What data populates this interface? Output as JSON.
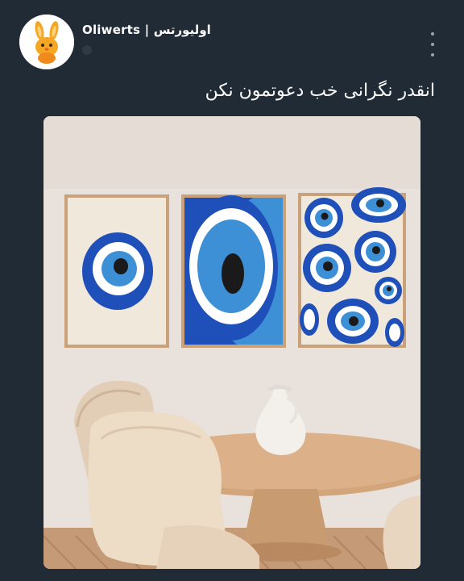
{
  "post": {
    "author_name": "Oliwerts | اولیورتس",
    "caption": "انقدر نگرانی خب دعوتمون نکن",
    "avatar_icon": "rabbit-mascot-icon",
    "more_icon": "more-vertical-icon"
  },
  "colors": {
    "background": "#212b35",
    "text": "#ffffff",
    "evil_eye_blue": "#1f4fb8",
    "evil_eye_light_blue": "#3d8fd6",
    "wall": "#e7ded8"
  }
}
